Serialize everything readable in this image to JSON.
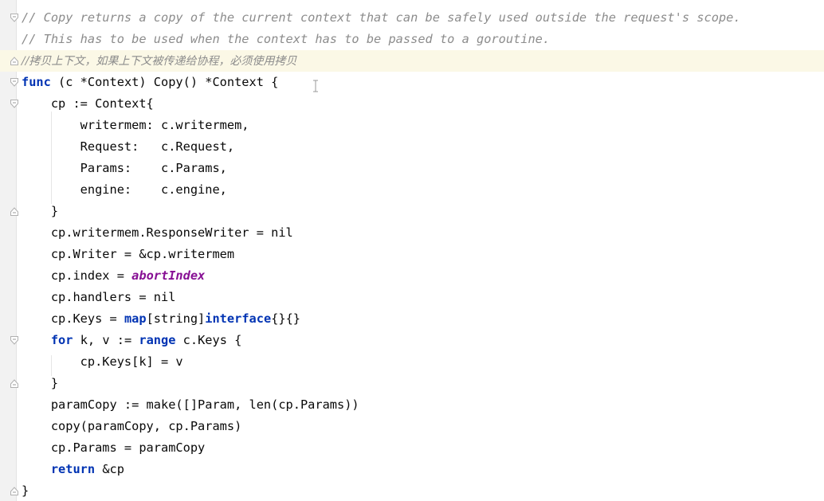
{
  "editor": {
    "language": "go",
    "lines": [
      {
        "tokens": [
          {
            "t": "// Copy returns a copy of the current context that can be safely used outside the request's scope.",
            "c": "cmt"
          }
        ],
        "fold": "start"
      },
      {
        "tokens": [
          {
            "t": "// This has to be used when the context has to be passed to a goroutine.",
            "c": "cmt"
          }
        ]
      },
      {
        "tokens": [
          {
            "t": "//拷贝上下文，如果上下文被传递给协程，必须使用拷贝",
            "c": "cmt-cn"
          }
        ],
        "fold": "end",
        "highlight": true
      },
      {
        "tokens": [
          {
            "t": "func",
            "c": "kw"
          },
          {
            "t": " (c *Context) Copy() *Context {",
            "c": ""
          }
        ],
        "fold": "start"
      },
      {
        "tokens": [
          {
            "t": "    cp := Context{",
            "c": ""
          }
        ],
        "fold": "start"
      },
      {
        "tokens": [
          {
            "t": "        writermem: c.writermem,",
            "c": ""
          }
        ]
      },
      {
        "tokens": [
          {
            "t": "        Request:   c.Request,",
            "c": ""
          }
        ]
      },
      {
        "tokens": [
          {
            "t": "        Params:    c.Params,",
            "c": ""
          }
        ]
      },
      {
        "tokens": [
          {
            "t": "        engine:    c.engine,",
            "c": ""
          }
        ]
      },
      {
        "tokens": [
          {
            "t": "    }",
            "c": ""
          }
        ],
        "fold": "end"
      },
      {
        "tokens": [
          {
            "t": "    cp.writermem.ResponseWriter = nil",
            "c": ""
          }
        ]
      },
      {
        "tokens": [
          {
            "t": "    cp.Writer = &cp.writermem",
            "c": ""
          }
        ]
      },
      {
        "tokens": [
          {
            "t": "    cp.index = ",
            "c": ""
          },
          {
            "t": "abortIndex",
            "c": "const"
          }
        ]
      },
      {
        "tokens": [
          {
            "t": "    cp.handlers = nil",
            "c": ""
          }
        ]
      },
      {
        "tokens": [
          {
            "t": "    cp.Keys = ",
            "c": ""
          },
          {
            "t": "map",
            "c": "kw"
          },
          {
            "t": "[string]",
            "c": ""
          },
          {
            "t": "interface",
            "c": "kw"
          },
          {
            "t": "{}{}",
            "c": ""
          }
        ]
      },
      {
        "tokens": [
          {
            "t": "    ",
            "c": ""
          },
          {
            "t": "for",
            "c": "kw"
          },
          {
            "t": " k, v := ",
            "c": ""
          },
          {
            "t": "range",
            "c": "kw"
          },
          {
            "t": " c.Keys {",
            "c": ""
          }
        ],
        "fold": "start"
      },
      {
        "tokens": [
          {
            "t": "        cp.Keys[k] = v",
            "c": ""
          }
        ]
      },
      {
        "tokens": [
          {
            "t": "    }",
            "c": ""
          }
        ],
        "fold": "end"
      },
      {
        "tokens": [
          {
            "t": "    paramCopy := make([]Param, len(cp.Params))",
            "c": ""
          }
        ]
      },
      {
        "tokens": [
          {
            "t": "    copy(paramCopy, cp.Params)",
            "c": ""
          }
        ]
      },
      {
        "tokens": [
          {
            "t": "    cp.Params = paramCopy",
            "c": ""
          }
        ]
      },
      {
        "tokens": [
          {
            "t": "    ",
            "c": ""
          },
          {
            "t": "return",
            "c": "kw"
          },
          {
            "t": " &cp",
            "c": ""
          }
        ]
      },
      {
        "tokens": [
          {
            "t": "}",
            "c": ""
          }
        ],
        "fold": "end"
      }
    ]
  },
  "icons": {
    "fold_start": "fold-collapse-icon",
    "fold_end": "fold-end-icon",
    "caret": "text-cursor-icon"
  },
  "colors": {
    "background": "#ffffff",
    "gutter": "#f2f2f2",
    "highlight_line": "#fbf8e6",
    "comment": "#8c8c8c",
    "keyword": "#0033b3",
    "constant": "#871094",
    "text": "#080808"
  }
}
